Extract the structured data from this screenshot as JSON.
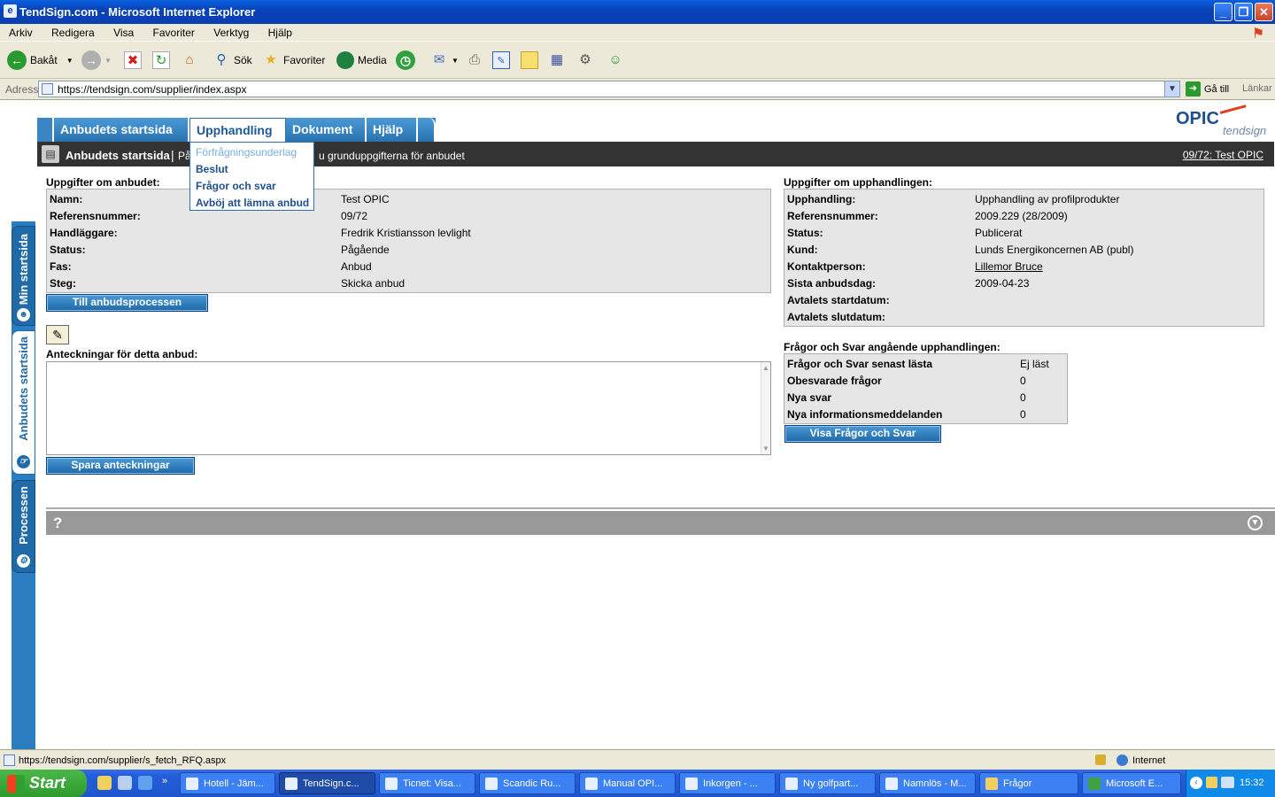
{
  "window": {
    "title": "TendSign.com - Microsoft Internet Explorer"
  },
  "menubar": [
    "Arkiv",
    "Redigera",
    "Visa",
    "Favoriter",
    "Verktyg",
    "Hjälp"
  ],
  "toolbar": {
    "back": "Bakåt",
    "search": "Sök",
    "favorites": "Favoriter",
    "media": "Media"
  },
  "address": {
    "label": "Adress",
    "url": "https://tendsign.com/supplier/index.aspx",
    "go": "Gå till",
    "links": "Länkar"
  },
  "side_tabs": {
    "min": "Min startsida",
    "anbud": "Anbudets startsida",
    "process": "Processen"
  },
  "nav": {
    "tabs": [
      "Anbudets startsida",
      "Upphandling",
      "Dokument",
      "Hjälp"
    ]
  },
  "dropdown": {
    "items": [
      "Förfrågningsunderlag",
      "Beslut",
      "Frågor och svar",
      "Avböj att lämna anbud"
    ]
  },
  "header": {
    "title": "Anbudets startsida",
    "sep": "|",
    "desc_left": "På",
    "desc_right": "u grunduppgifterna för anbudet",
    "right_link": "09/72: Test OPIC"
  },
  "logo": {
    "name": "OPIC",
    "sub": "tendsign"
  },
  "bid": {
    "title": "Uppgifter om anbudet:",
    "rows": [
      {
        "k": "Namn:",
        "v": "Test OPIC"
      },
      {
        "k": "Referensnummer:",
        "v": "09/72"
      },
      {
        "k": "Handläggare:",
        "v": "Fredrik Kristiansson levlight"
      },
      {
        "k": "Status:",
        "v": "Pågående"
      },
      {
        "k": "Fas:",
        "v": "Anbud"
      },
      {
        "k": "Steg:",
        "v": "Skicka anbud"
      }
    ],
    "button": "Till anbudsprocessen"
  },
  "notes": {
    "title": "Anteckningar för detta anbud:",
    "value": "",
    "button": "Spara anteckningar"
  },
  "procurement": {
    "title": "Uppgifter om upphandlingen:",
    "rows": [
      {
        "k": "Upphandling:",
        "v": "Upphandling av profilprodukter"
      },
      {
        "k": "Referensnummer:",
        "v": "2009.229 (28/2009)"
      },
      {
        "k": "Status:",
        "v": "Publicerat"
      },
      {
        "k": "Kund:",
        "v": "Lunds Energikoncernen AB (publ)"
      },
      {
        "k": "Kontaktperson:",
        "v": "Lillemor Bruce"
      },
      {
        "k": "Sista anbudsdag:",
        "v": "2009-04-23"
      },
      {
        "k": "Avtalets startdatum:",
        "v": ""
      },
      {
        "k": "Avtalets slutdatum:",
        "v": ""
      }
    ]
  },
  "qa": {
    "title": "Frågor och Svar angående upphandlingen:",
    "rows": [
      {
        "k": "Frågor och Svar senast lästa",
        "v": "Ej läst"
      },
      {
        "k": "Obesvarade frågor",
        "v": "0"
      },
      {
        "k": "Nya svar",
        "v": "0"
      },
      {
        "k": "Nya informationsmeddelanden",
        "v": "0"
      }
    ],
    "button": "Visa Frågor och Svar"
  },
  "helpbar": {
    "q": "?"
  },
  "status": {
    "url": "https://tendsign.com/supplier/s_fetch_RFQ.aspx",
    "zone": "Internet"
  },
  "taskbar": {
    "start": "Start",
    "tasks": [
      "Hotell - Jäm...",
      "TendSign.c...",
      "Ticnet: Visa...",
      "Scandic Ru...",
      "Manual OPI...",
      "Inkorgen - ...",
      "Ny golfpart...",
      "Namnlös - M...",
      "Frågor",
      "Microsoft E..."
    ],
    "clock": "15:32",
    "chevron": "»"
  }
}
